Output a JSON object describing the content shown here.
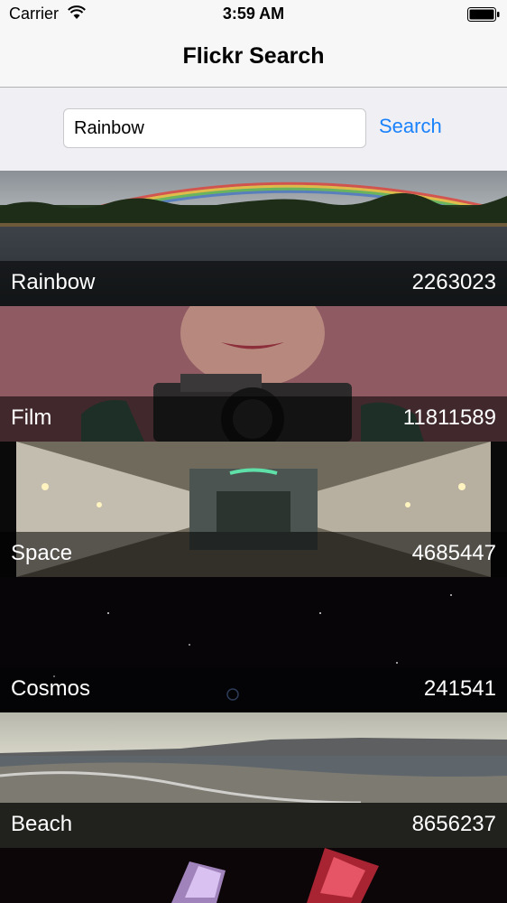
{
  "status_bar": {
    "carrier": "Carrier",
    "time": "3:59 AM"
  },
  "nav": {
    "title": "Flickr Search"
  },
  "search": {
    "value": "Rainbow",
    "button_label": "Search"
  },
  "colors": {
    "accent": "#1a82fb",
    "background": "#efeff4"
  },
  "results": [
    {
      "name": "Rainbow",
      "count": "2263023"
    },
    {
      "name": "Film",
      "count": "11811589"
    },
    {
      "name": "Space",
      "count": "4685447"
    },
    {
      "name": "Cosmos",
      "count": "241541"
    },
    {
      "name": "Beach",
      "count": "8656237"
    }
  ]
}
